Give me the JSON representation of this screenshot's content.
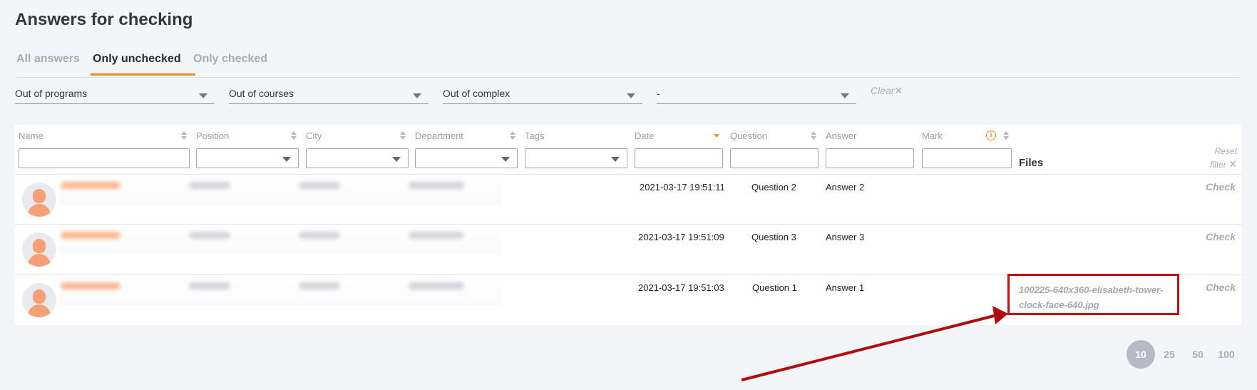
{
  "page": {
    "title": "Answers for checking"
  },
  "tabs": [
    {
      "label": "All answers",
      "active": false
    },
    {
      "label": "Only unchecked",
      "active": true
    },
    {
      "label": "Only checked",
      "active": false
    }
  ],
  "filters": {
    "programs": "Out of programs",
    "courses": "Out of courses",
    "complex": "Out of complex",
    "extra": "-",
    "clear_label": "Clear"
  },
  "table": {
    "headers": {
      "name": "Name",
      "position": "Position",
      "city": "City",
      "department": "Department",
      "tags": "Tags",
      "date": "Date",
      "question": "Question",
      "answer": "Answer",
      "mark": "Mark",
      "files": "Files"
    },
    "reset_filter_line1": "Reset",
    "reset_filter_line2": "filter",
    "rows": [
      {
        "date": "2021-03-17 19:51:11",
        "question": "Question 2",
        "answer": "Answer 2",
        "file": "",
        "action": "Check"
      },
      {
        "date": "2021-03-17 19:51:09",
        "question": "Question 3",
        "answer": "Answer 3",
        "file": "",
        "action": "Check"
      },
      {
        "date": "2021-03-17 19:51:03",
        "question": "Question 1",
        "answer": "Answer 1",
        "file": "100225-640x360-elisabeth-tower-clock-face-640.jpg",
        "action": "Check"
      }
    ]
  },
  "pagination": {
    "options": [
      "10",
      "25",
      "50",
      "100"
    ],
    "selected": "10"
  },
  "colors": {
    "accent": "#f08c2a",
    "highlight": "#c00f0f"
  }
}
